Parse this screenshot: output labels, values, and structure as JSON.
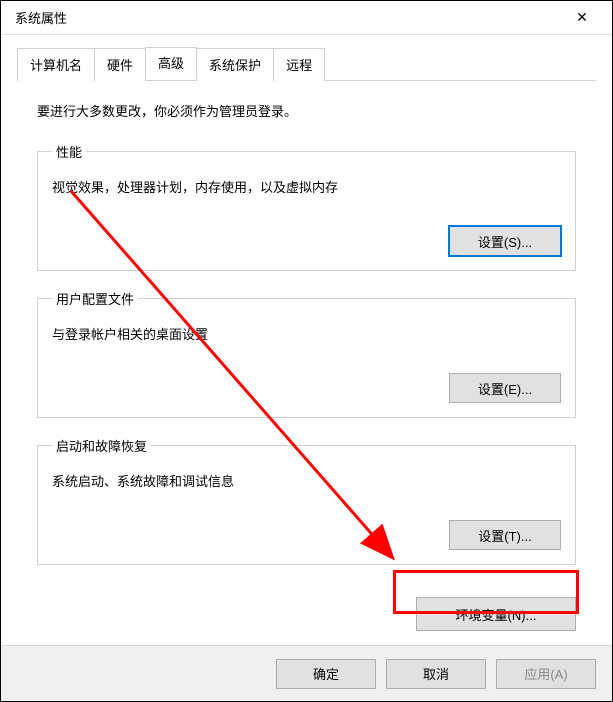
{
  "window": {
    "title": "系统属性",
    "close_icon": "✕"
  },
  "tabs": {
    "computer_name": "计算机名",
    "hardware": "硬件",
    "advanced": "高级",
    "system_protection": "系统保护",
    "remote": "远程"
  },
  "advanced": {
    "admin_hint": "要进行大多数更改，你必须作为管理员登录。",
    "performance": {
      "legend": "性能",
      "desc": "视觉效果，处理器计划，内存使用，以及虚拟内存",
      "button": "设置(S)..."
    },
    "user_profiles": {
      "legend": "用户配置文件",
      "desc": "与登录帐户相关的桌面设置",
      "button": "设置(E)..."
    },
    "startup_recovery": {
      "legend": "启动和故障恢复",
      "desc": "系统启动、系统故障和调试信息",
      "button": "设置(T)..."
    },
    "env_vars_button": "环境变量(N)..."
  },
  "footer": {
    "ok": "确定",
    "cancel": "取消",
    "apply": "应用(A)"
  }
}
